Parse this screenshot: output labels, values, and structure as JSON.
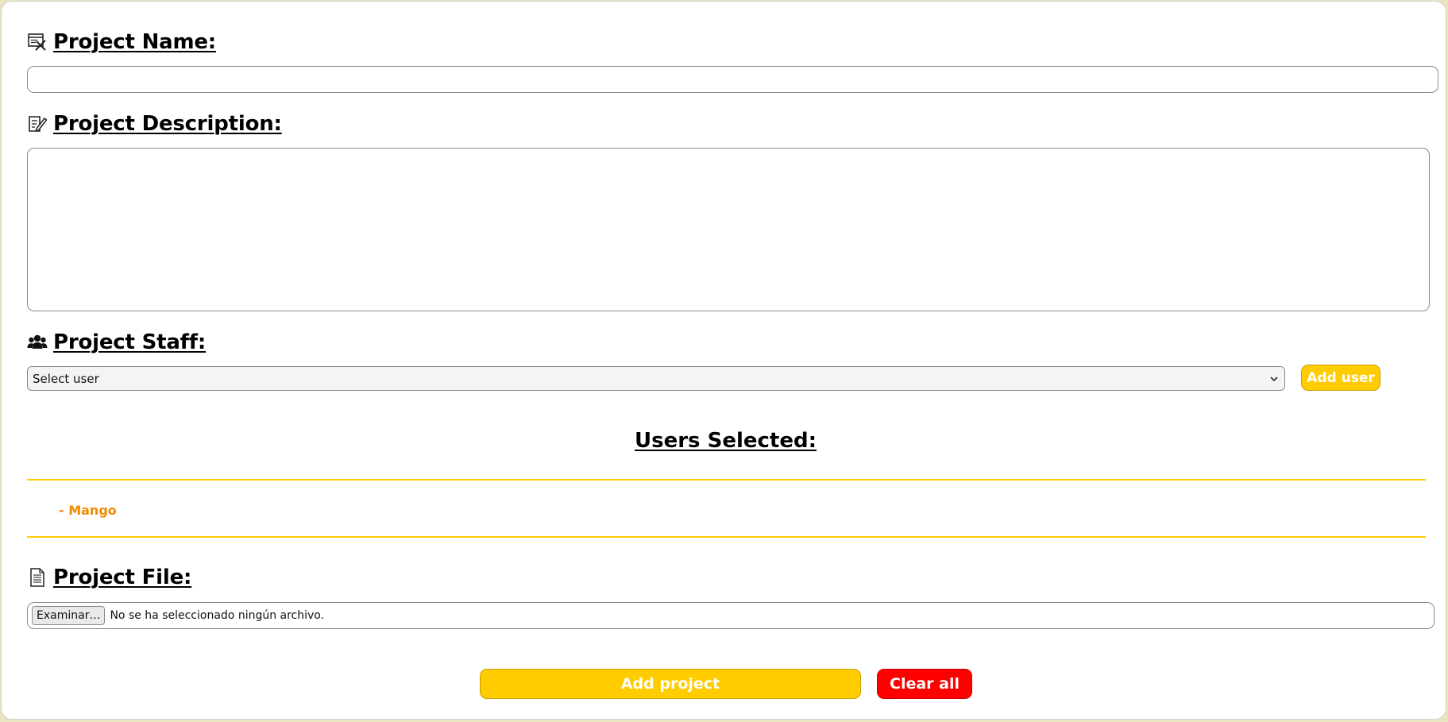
{
  "form": {
    "name_label": "Project Name:",
    "name_value": "",
    "description_label": "Project Description:",
    "description_value": "",
    "staff_label": "Project Staff:",
    "staff_select_value": "Select user",
    "add_user_label": "Add user",
    "users_selected_title": "Users Selected:",
    "selected_users": [
      "- Mango"
    ],
    "file_label": "Project File:",
    "file_browse_label": "Examinar…",
    "file_status": "No se ha seleccionado ningún archivo.",
    "add_project_label": "Add project",
    "clear_all_label": "Clear all"
  },
  "icons": {
    "name": "project-name-icon",
    "description": "edit-document-icon",
    "staff": "users-group-icon",
    "file": "file-icon"
  },
  "colors": {
    "accent_yellow": "#ffcc00",
    "danger_red": "#ff0000",
    "user_item_orange": "#f08a00"
  }
}
